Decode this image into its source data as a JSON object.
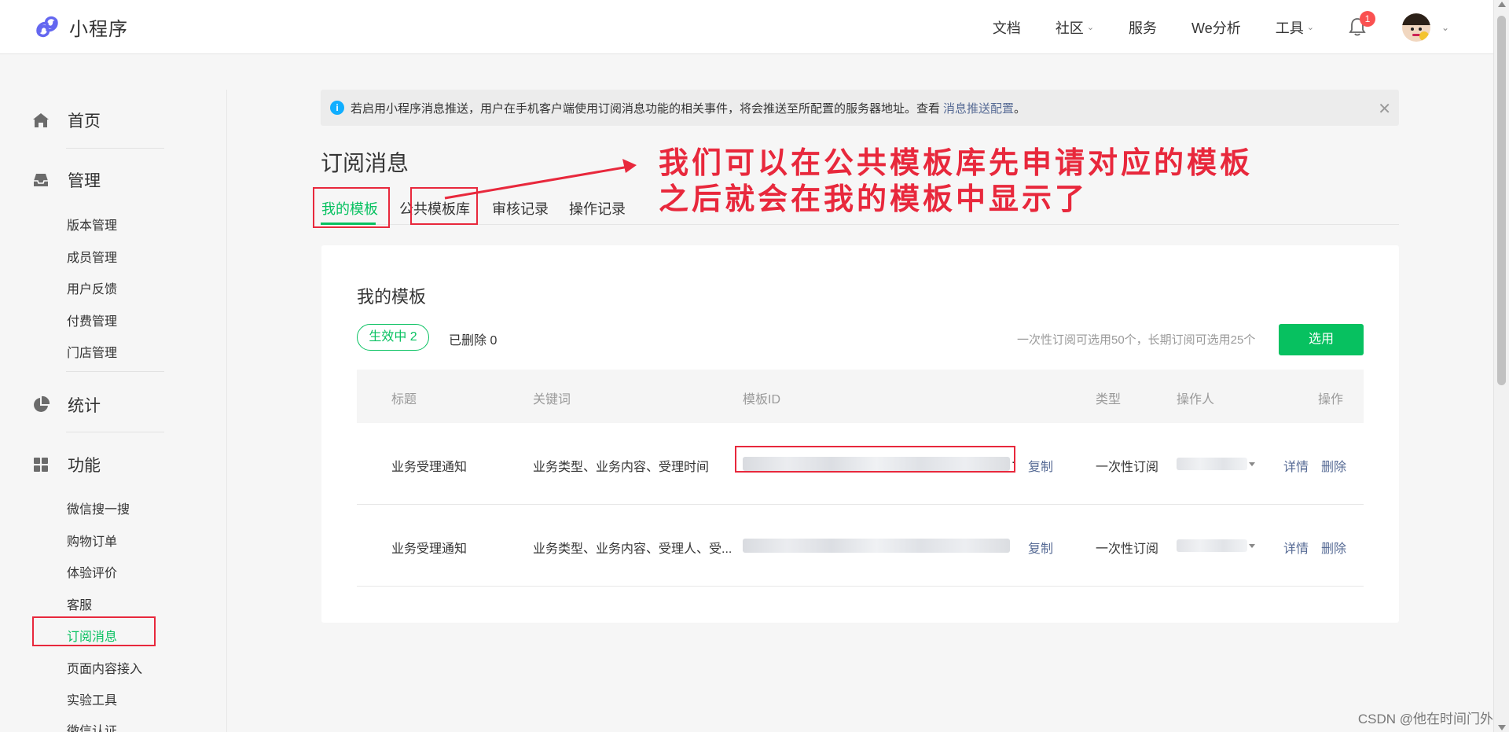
{
  "header": {
    "app_title": "小程序",
    "nav": [
      "文档",
      "社区",
      "服务",
      "We分析",
      "工具"
    ],
    "notification_count": "1"
  },
  "sidebar": {
    "sections": [
      {
        "label": "首页",
        "icon": "home-icon"
      },
      {
        "label": "管理",
        "icon": "inbox-icon"
      },
      {
        "label": "统计",
        "icon": "pie-chart-icon"
      },
      {
        "label": "功能",
        "icon": "grid-icon"
      }
    ],
    "manage_items": [
      "版本管理",
      "成员管理",
      "用户反馈",
      "付费管理",
      "门店管理"
    ],
    "feature_items": [
      "微信搜一搜",
      "购物订单",
      "体验评价",
      "客服",
      "订阅消息",
      "页面内容接入",
      "实验工具",
      "微信认证"
    ]
  },
  "notice": {
    "text": "若启用小程序消息推送，用户在手机客户端使用订阅消息功能的相关事件，将会推送至所配置的服务器地址。查看",
    "link": "消息推送配置",
    "end": "。"
  },
  "page": {
    "title": "订阅消息",
    "tabs": [
      "我的模板",
      "公共模板库",
      "审核记录",
      "操作记录"
    ]
  },
  "annotation": {
    "text": "我们可以在公共模板库先申请对应的模板\n之后就会在我的模板中显示了",
    "color": "#e8283c"
  },
  "card": {
    "title": "我的模板",
    "chip_active": "生效中  2",
    "chip_deleted": "已删除  0",
    "quota_tip": "一次性订阅可选用50个，长期订阅可选用25个",
    "select_button": "选用",
    "columns": [
      "标题",
      "关键词",
      "模板ID",
      "类型",
      "操作人",
      "操作"
    ],
    "rows": [
      {
        "title": "业务受理通知",
        "keywords": "业务类型、业务内容、受理时间",
        "copy": "复制",
        "type": "一次性订阅",
        "detail": "详情",
        "delete": "删除"
      },
      {
        "title": "业务受理通知",
        "keywords": "业务类型、业务内容、受理人、受...",
        "copy": "复制",
        "type": "一次性订阅",
        "detail": "详情",
        "delete": "删除"
      }
    ]
  },
  "watermark": "CSDN @他在时间门外",
  "colors": {
    "brand_green": "#07c160",
    "link_blue": "#576b95",
    "annotation_red": "#e8283c",
    "badge_red": "#fa5151"
  }
}
